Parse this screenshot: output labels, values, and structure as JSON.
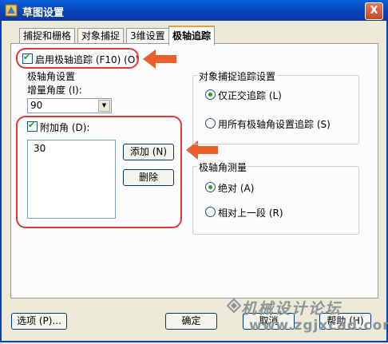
{
  "window": {
    "title": "草图设置",
    "close_symbol": "X"
  },
  "tabs": [
    {
      "label": "捕捉和栅格",
      "active": false
    },
    {
      "label": "对象捕捉",
      "active": false
    },
    {
      "label": "3维设置",
      "active": false
    },
    {
      "label": "极轴追踪",
      "active": true
    }
  ],
  "polar": {
    "enable_label": "启用极轴追踪 (F10) (O)",
    "enable_checked": true,
    "angle_group_title": "极轴角设置",
    "increment_label": "增量角度 (I):",
    "increment_value": "90",
    "additional_label": "附加角 (D):",
    "additional_checked": true,
    "additional_angles": [
      "30"
    ],
    "add_button": "添加 (N)",
    "delete_button": "删除"
  },
  "tracking": {
    "group_title": "对象捕捉追踪设置",
    "options": [
      {
        "label": "仅正交追踪 (L)",
        "selected": true
      },
      {
        "label": "用所有极轴角设置追踪 (S)",
        "selected": false
      }
    ]
  },
  "measurement": {
    "group_title": "极轴角测量",
    "options": [
      {
        "label": "绝对 (A)",
        "selected": true
      },
      {
        "label": "相对上一段 (R)",
        "selected": false
      }
    ]
  },
  "footer": {
    "options_button": "选项 (P)...",
    "ok_button": "确定",
    "cancel_button": "取消",
    "help_button": "帮助 (H)"
  },
  "watermark": {
    "line1": "机械设计论坛",
    "line2": "www.zgjxcad.com"
  },
  "colors": {
    "annotation_red": "#E03A35",
    "annotation_arrow": "#E8602C",
    "title_blue": "#0842B8"
  }
}
